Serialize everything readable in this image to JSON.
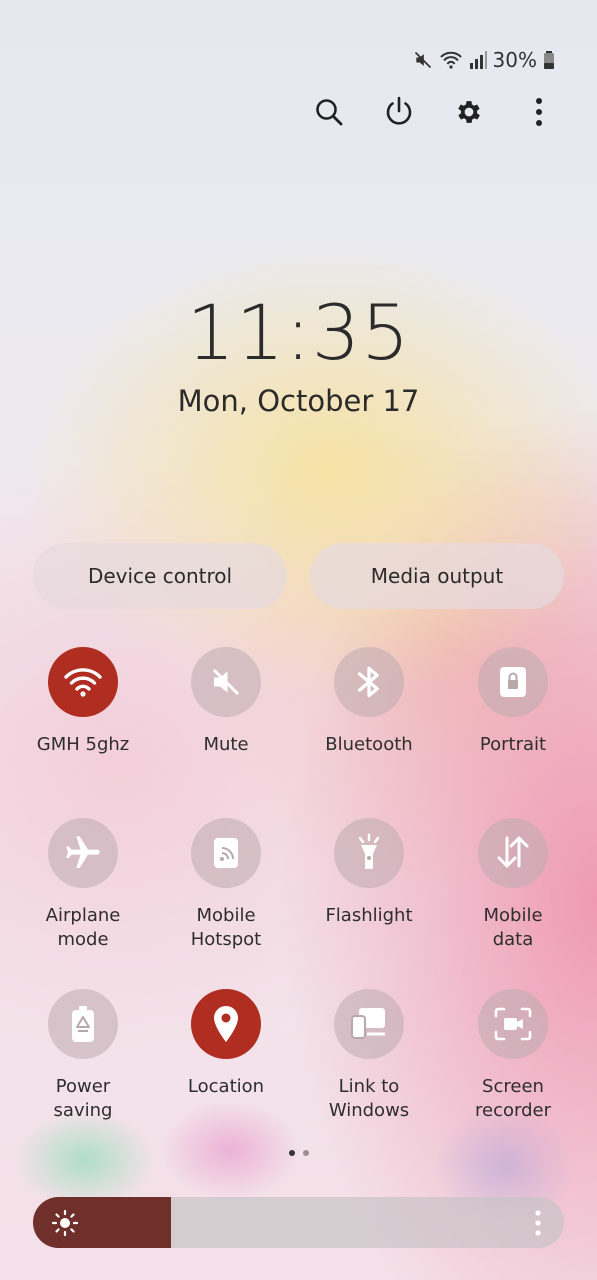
{
  "status_bar": {
    "battery_text": "30%",
    "icons": [
      "mute-icon",
      "wifi-icon",
      "signal-icon",
      "battery-icon"
    ]
  },
  "top_actions": [
    "search-icon",
    "power-icon",
    "settings-icon",
    "more-vertical-icon"
  ],
  "clock": {
    "time": "11:35",
    "date": "Mon, October 17"
  },
  "pills": {
    "device_control": "Device control",
    "media_output": "Media output"
  },
  "tiles": [
    {
      "label": "GMH 5ghz",
      "icon": "wifi-icon",
      "active": true
    },
    {
      "label": "Mute",
      "icon": "mute-icon",
      "active": false
    },
    {
      "label": "Bluetooth",
      "icon": "bluetooth-icon",
      "active": false
    },
    {
      "label": "Portrait",
      "icon": "portrait-lock-icon",
      "active": false
    },
    {
      "label": "Airplane\nmode",
      "icon": "airplane-icon",
      "active": false
    },
    {
      "label": "Mobile\nHotspot",
      "icon": "hotspot-icon",
      "active": false
    },
    {
      "label": "Flashlight",
      "icon": "flashlight-icon",
      "active": false
    },
    {
      "label": "Mobile\ndata",
      "icon": "mobile-data-icon",
      "active": false
    },
    {
      "label": "Power\nsaving",
      "icon": "power-saving-icon",
      "active": false
    },
    {
      "label": "Location",
      "icon": "location-icon",
      "active": true
    },
    {
      "label": "Link to\nWindows",
      "icon": "link-to-windows-icon",
      "active": false
    },
    {
      "label": "Screen recorder",
      "icon": "screen-recorder-icon",
      "active": false
    }
  ],
  "pagination": {
    "current": 1,
    "total": 2
  },
  "brightness": {
    "level": 0.26,
    "accent": "#6f302b"
  },
  "colors": {
    "active_tile": "#b02d22"
  }
}
